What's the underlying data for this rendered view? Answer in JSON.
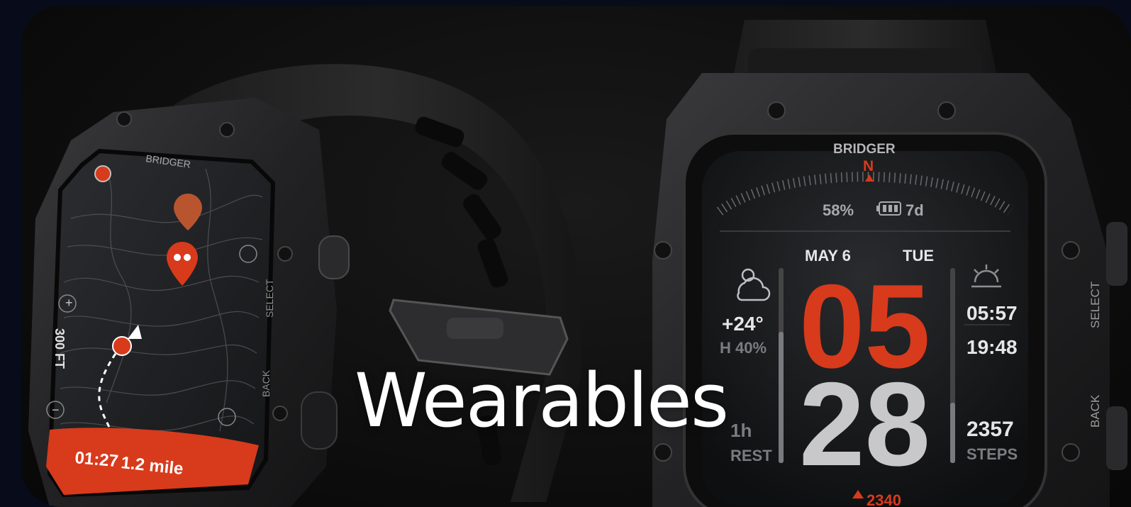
{
  "hero": {
    "title": "Wearables"
  },
  "watch_left": {
    "brand": "BRIDGER",
    "select_label": "SELECT",
    "back_label": "BACK",
    "scale_label": "300 FT",
    "plus": "+",
    "minus": "−",
    "track_time": "01:27",
    "track_distance": "1.2 mile",
    "accent": "#d83a1c"
  },
  "watch_right": {
    "brand": "BRIDGER",
    "compass_north": "N",
    "battery": "58%",
    "battery_days": "7d",
    "date": "MAY 6",
    "weekday": "TUE",
    "hour": "05",
    "minute": "28",
    "temperature": "+24°",
    "humidity": "H 40%",
    "sunrise": "05:57",
    "sunset": "19:48",
    "steps": "2357",
    "steps_label": "STEPS",
    "rest_value": "1h",
    "rest_label": "REST",
    "altitude": "2340",
    "select_label": "SELECT",
    "back_label": "BACK",
    "accent": "#d83a1c"
  }
}
